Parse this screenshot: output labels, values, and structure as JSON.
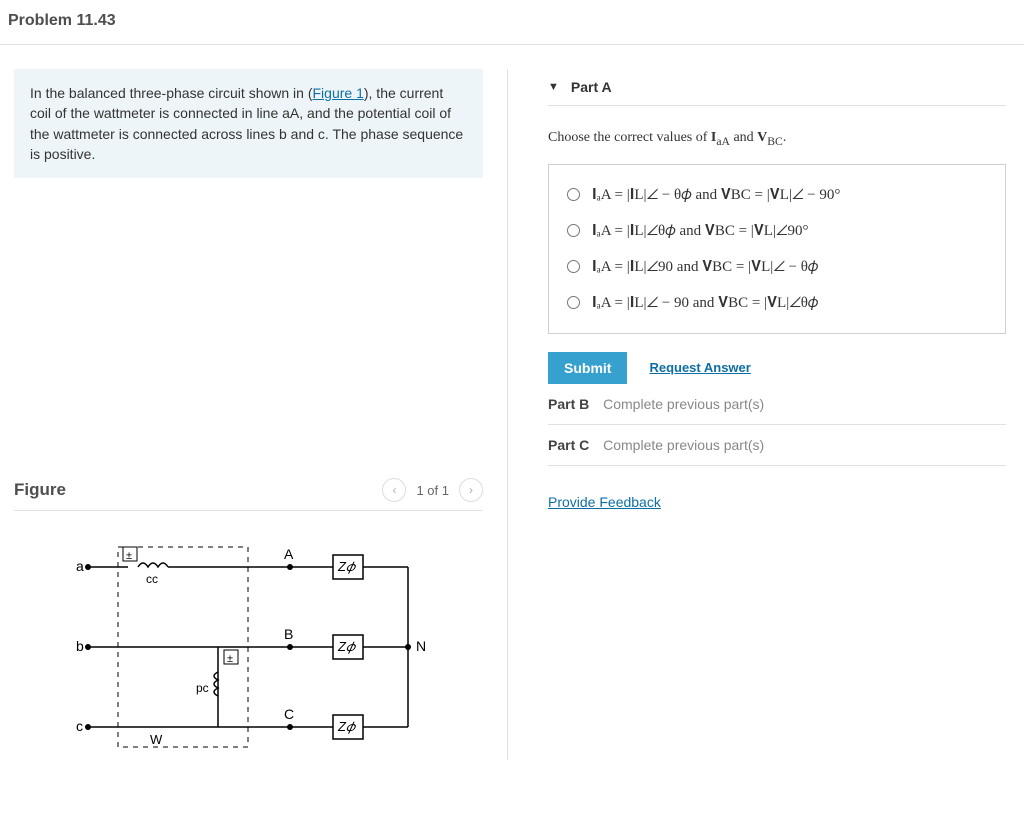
{
  "header": {
    "title": "Problem 11.43"
  },
  "intro": {
    "before_link": "In the balanced three-phase circuit shown in (",
    "link_text": "Figure 1",
    "after_link": "), the current coil of the wattmeter is connected in line aA, and the potential coil of the wattmeter is connected across lines b and c. The phase sequence is positive."
  },
  "figure": {
    "heading": "Figure",
    "pager_label": "1 of 1",
    "labels": {
      "a": "a",
      "b": "b",
      "c": "c",
      "A": "A",
      "B": "B",
      "C": "C",
      "N": "N",
      "W": "W",
      "cc": "cc",
      "pc": "pc",
      "Z1": "Z𝜙",
      "Z2": "Z𝜙",
      "Z3": "Z𝜙"
    }
  },
  "partA": {
    "label": "Part A",
    "prompt_prefix": "Choose the correct values of ",
    "prompt_mid": " and ",
    "prompt_suffix": ".",
    "IaA": "I",
    "IaA_sub": "aA",
    "VBC": "V",
    "VBC_sub": "BC",
    "options": [
      "𝐈ₐA = |𝐈L|∠ − θ𝜙 and 𝐕BC = |𝐕L|∠ − 90°",
      "𝐈ₐA = |𝐈L|∠θ𝜙 and 𝐕BC = |𝐕L|∠90°",
      "𝐈ₐA = |𝐈L|∠90 and 𝐕BC = |𝐕L|∠ − θ𝜙",
      "𝐈ₐA = |𝐈L|∠ − 90 and 𝐕BC = |𝐕L|∠θ𝜙"
    ],
    "submit": "Submit",
    "request": "Request Answer"
  },
  "partB": {
    "label": "Part B",
    "msg": "Complete previous part(s)"
  },
  "partC": {
    "label": "Part C",
    "msg": "Complete previous part(s)"
  },
  "feedback": "Provide Feedback"
}
